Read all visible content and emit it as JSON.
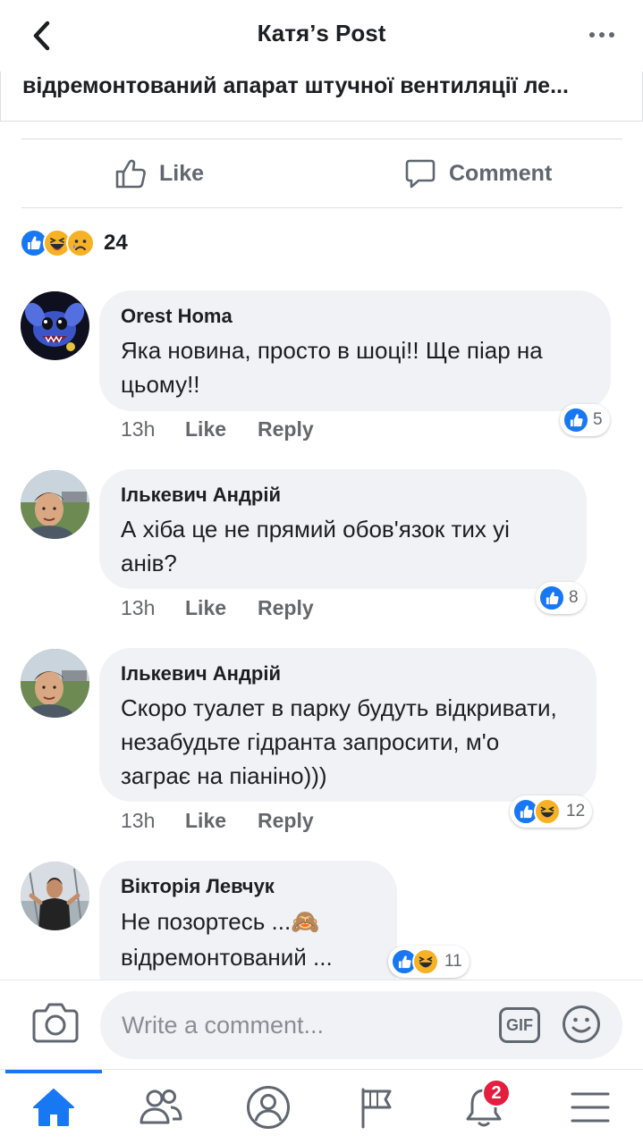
{
  "header": {
    "title": "Катя’s Post",
    "back_icon": "chevron-left-icon",
    "more_icon": "more-horizontal-icon"
  },
  "post": {
    "preview_text": "відремонтований апарат штучної вентиляції ле..."
  },
  "actions": {
    "like_label": "Like",
    "comment_label": "Comment"
  },
  "reactions": {
    "types": [
      "like",
      "haha",
      "sad"
    ],
    "count": "24"
  },
  "comments": [
    {
      "author": "Orest Homa",
      "text": "Яка новина, просто в шоці!! Ще піар на цьому!!",
      "time": "13h",
      "like_label": "Like",
      "reply_label": "Reply",
      "reactions": [
        "like"
      ],
      "reaction_count": "5"
    },
    {
      "author": "Ількевич Андрій",
      "text": "А хіба це не прямий обов'язок тих уі анів?",
      "time": "13h",
      "like_label": "Like",
      "reply_label": "Reply",
      "reactions": [
        "like"
      ],
      "reaction_count": "8"
    },
    {
      "author": "Ількевич Андрій",
      "text": "Скоро туалет в парку будуть відкривати, незабудьте гідранта запросити, м'о заграє на піаніно)))",
      "time": "13h",
      "like_label": "Like",
      "reply_label": "Reply",
      "reactions": [
        "like",
        "haha"
      ],
      "reaction_count": "12"
    },
    {
      "author": "Вікторія Левчук",
      "text": "Не позортесь ...🙈 відремонтований ...",
      "reactions": [
        "like",
        "haha"
      ],
      "reaction_count": "11"
    }
  ],
  "composer": {
    "placeholder": "Write a comment...",
    "gif_label": "GIF",
    "camera_icon": "camera-icon",
    "emoji_icon": "smiley-icon"
  },
  "nav": {
    "items": [
      "home-icon",
      "friends-icon",
      "profile-icon",
      "pages-flag-icon",
      "notifications-bell-icon",
      "menu-icon"
    ],
    "notifications_badge": "2",
    "active_color": "#1877f2"
  },
  "colors": {
    "accent": "#1877f2",
    "bubble": "#f0f2f5",
    "secondary_text": "#65676b",
    "badge": "#e41e3f"
  }
}
